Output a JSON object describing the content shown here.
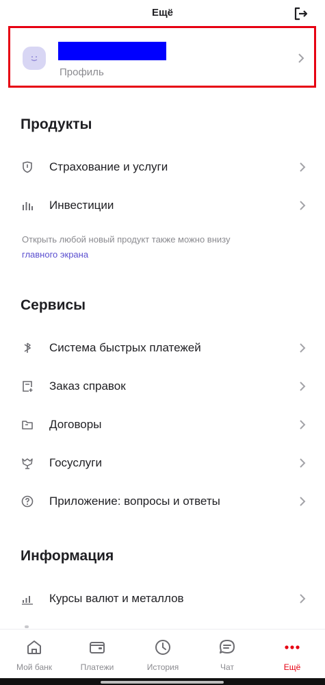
{
  "header": {
    "title": "Ещё",
    "logout_icon": "logout-icon"
  },
  "profile": {
    "name_redacted": true,
    "subtitle": "Профиль",
    "avatar_icon": "avatar-smile-icon",
    "highlight_color": "#e60012",
    "redaction_color": "#0000ff"
  },
  "products": {
    "title": "Продукты",
    "items": [
      {
        "label": "Страхование и услуги",
        "icon": "shield-icon"
      },
      {
        "label": "Инвестиции",
        "icon": "bar-chart-icon"
      }
    ],
    "hint": "Открыть любой новый продукт также можно внизу",
    "hint_link": "главного экрана"
  },
  "services": {
    "title": "Сервисы",
    "items": [
      {
        "label": "Система быстрых платежей",
        "icon": "sbp-icon"
      },
      {
        "label": "Заказ справок",
        "icon": "document-add-icon"
      },
      {
        "label": "Договоры",
        "icon": "folder-icon"
      },
      {
        "label": "Госуслуги",
        "icon": "gov-emblem-icon"
      },
      {
        "label": "Приложение: вопросы и ответы",
        "icon": "help-circle-icon"
      }
    ]
  },
  "information": {
    "title": "Информация",
    "items": [
      {
        "label": "Курсы валют и металлов",
        "icon": "rates-chart-icon"
      }
    ]
  },
  "bottom_nav": {
    "items": [
      {
        "label": "Мой банк",
        "icon": "home-icon",
        "active": false
      },
      {
        "label": "Платежи",
        "icon": "wallet-icon",
        "active": false
      },
      {
        "label": "История",
        "icon": "clock-icon",
        "active": false
      },
      {
        "label": "Чат",
        "icon": "chat-icon",
        "active": false
      },
      {
        "label": "Ещё",
        "icon": "more-dots-icon",
        "active": true
      }
    ],
    "active_color": "#e60012"
  }
}
